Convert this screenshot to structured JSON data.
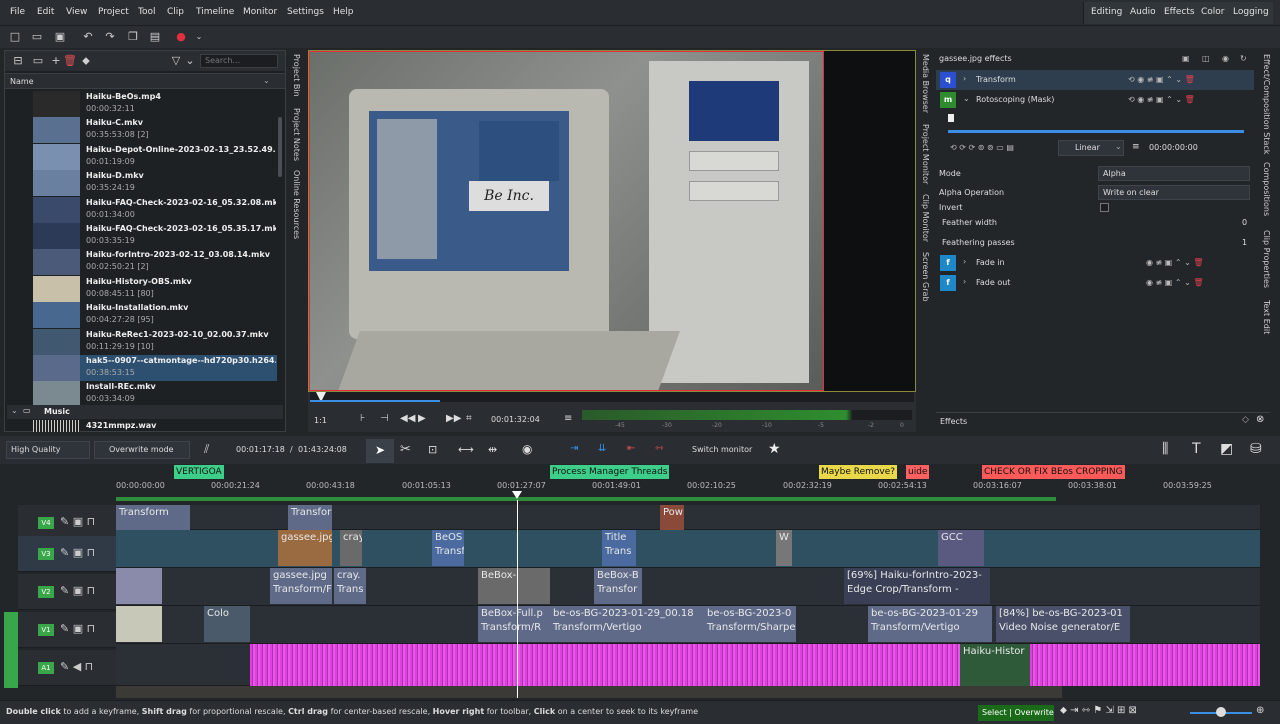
{
  "menu": [
    "File",
    "Edit",
    "View",
    "Project",
    "Tool",
    "Clip",
    "Timeline",
    "Monitor",
    "Settings",
    "Help"
  ],
  "workspaces": [
    "Editing",
    "Audio",
    "Effects",
    "Color",
    "Logging"
  ],
  "bin": {
    "search_placeholder": "Search...",
    "column": "Name",
    "folder_music": "Music",
    "clips": [
      {
        "name": "Haiku-BeOs.mp4",
        "dur": "00:00:32:11"
      },
      {
        "name": "Haiku-C.mkv",
        "dur": "00:35:53:08 [2]"
      },
      {
        "name": "Haiku-Depot-Online-2023-02-13_23.52.49.mkv",
        "dur": "00:01:19:09"
      },
      {
        "name": "Haiku-D.mkv",
        "dur": "00:35:24:19"
      },
      {
        "name": "Haiku-FAQ-Check-2023-02-16_05.32.08.mkv",
        "dur": "00:01:34:00"
      },
      {
        "name": "Haiku-FAQ-Check-2023-02-16_05.35.17.mkv",
        "dur": "00:03:35:19"
      },
      {
        "name": "Haiku-forIntro-2023-02-12_03.08.14.mkv",
        "dur": "00:02:50:21 [2]"
      },
      {
        "name": "Haiku-History-OBS.mkv",
        "dur": "00:08:45:11 [80]"
      },
      {
        "name": "Haiku-Installation.mkv",
        "dur": "00:04:27:28 [95]"
      },
      {
        "name": "Haiku-ReRec1-2023-02-10_02.00.37.mkv",
        "dur": "00:11:29:19 [10]"
      },
      {
        "name": "hak5--0907--catmontage--hd720p30.h264.mp4",
        "dur": "00:38:53:15"
      },
      {
        "name": "Install-REc.mkv",
        "dur": "00:03:34:09"
      }
    ],
    "music_clip": "4321mmpz.wav"
  },
  "bin_tabs": [
    "Project Bin",
    "Project Notes",
    "Online Resources"
  ],
  "monitor_tabs": [
    "Media Browser",
    "Project Monitor",
    "Clip Monitor",
    "Screen Grab"
  ],
  "right_tabs": [
    "Effect/Composition Stack",
    "Compositions",
    "Clip Properties",
    "Text Edit"
  ],
  "monitor": {
    "zoom": "1:1",
    "timecode": "00:01:32:04",
    "meter": [
      "-45",
      "-30",
      "-20",
      "-10",
      "-5",
      "-2",
      "0"
    ]
  },
  "effects": {
    "title": "gassee.jpg effects",
    "items": [
      {
        "badge": "q",
        "name": "Transform",
        "color": "#2a4fd0"
      },
      {
        "badge": "m",
        "name": "Rotoscoping (Mask)",
        "color": "#2e8b2e"
      }
    ],
    "interp": "Linear",
    "kf_time": "00:00:00:00",
    "mode_label": "Mode",
    "mode_value": "Alpha",
    "alphaop_label": "Alpha Operation",
    "alphaop_value": "Write on clear",
    "invert_label": "Invert",
    "feather_label": "Feather width",
    "feather_value": "0",
    "passes_label": "Feathering passes",
    "passes_value": "1",
    "fades": [
      {
        "badge": "f",
        "name": "Fade in"
      },
      {
        "badge": "f",
        "name": "Fade out"
      }
    ],
    "bottom_label": "Effects"
  },
  "timeline": {
    "quality": "High Quality",
    "mode": "Overwrite mode",
    "position": "00:01:17:18",
    "duration": "01:43:24:08",
    "switch": "Switch monitor",
    "guides": [
      {
        "label": "VERTIGOA",
        "color": "#3dcf8a"
      },
      {
        "label": "Process Manager Threads",
        "color": "#3dcf8a"
      },
      {
        "label": "Maybe Remove?",
        "color": "#e8d84a"
      },
      {
        "label": "uide",
        "color": "#ff6060"
      },
      {
        "label": "CHECK OR FIX BEos CROPPING",
        "color": "#ff5a5a"
      }
    ],
    "ruler": [
      "00:00:00:00",
      "00:00:21:24",
      "00:00:43:18",
      "00:01:05:13",
      "00:01:27:07",
      "00:01:49:01",
      "00:02:10:25",
      "00:02:32:19",
      "00:02:54:13",
      "00:03:16:07",
      "00:03:38:01",
      "00:03:59:25"
    ],
    "tracks": [
      "V4",
      "V3",
      "V2",
      "V1",
      "A1"
    ],
    "clips": {
      "v4": [
        "Transform",
        "Transfor",
        "Pow"
      ],
      "v3": [
        "gassee.jpg",
        "cray",
        "BeOS",
        "Transf",
        "Title",
        "Trans",
        "W",
        "GCC"
      ],
      "v2": [
        "gassee.jpg",
        "Transform/F",
        "cray.",
        "Trans",
        "BeBox-",
        "BeBox-B",
        "Transfor",
        "[69%] Haiku-forIntro-2023-",
        "Edge Crop/Transform -"
      ],
      "v1": [
        "Colo",
        "BeBox-Full.p",
        "Transform/R",
        "be-os-BG-2023-01-29_00.18",
        "Transform/Vertigo",
        "be-os-BG-2023-0",
        "Transform/Sharpe",
        "be-os-BG-2023-01-29",
        "Transform/Vertigo",
        "[84%] be-os-BG-2023-01",
        "Video Noise generator/E"
      ],
      "a1": [
        "Haiku-Histor"
      ]
    }
  },
  "status": {
    "b1": "Double click",
    "t1": " to add a keyframe, ",
    "b2": "Shift drag",
    "t2": " for proportional rescale, ",
    "b3": "Ctrl drag",
    "t3": " for center-based rescale, ",
    "b4": "Hover right",
    "t4": " for toolbar, ",
    "b5": "Click",
    "t5": " on a center to seek to its keyframe",
    "mode": "Select | Overwrite"
  }
}
